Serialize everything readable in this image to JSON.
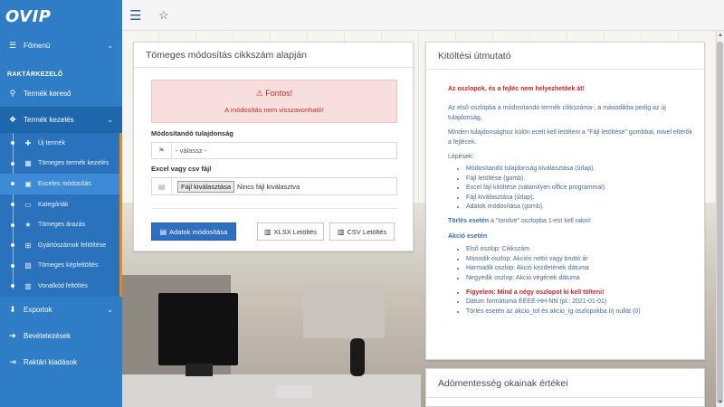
{
  "brand": {
    "logo_text": "OVIP"
  },
  "sidebar": {
    "top_item": {
      "label": "Főmenü",
      "icon": "bars-icon"
    },
    "section_title": "RAKTÁRKEZELŐ",
    "items": [
      {
        "label": "Termék kereső",
        "icon": "search-icon"
      },
      {
        "label": "Termék kezelés",
        "icon": "cubes-icon"
      }
    ],
    "submenu": [
      {
        "label": "Új termék",
        "icon": "plus-icon"
      },
      {
        "label": "Tömeges termék kezelés",
        "icon": "table-icon"
      },
      {
        "label": "Exceles módosítás",
        "icon": "file-excel-icon"
      },
      {
        "label": "Kategóriák",
        "icon": "folder-open-icon"
      },
      {
        "label": "Tömeges árazás",
        "icon": "star-icon"
      },
      {
        "label": "Gyártószámok feltöltése",
        "icon": "sitemap-icon"
      },
      {
        "label": "Tömeges képfeltöltés",
        "icon": "image-icon"
      },
      {
        "label": "Vonalkód feltöltés",
        "icon": "barcode-icon"
      }
    ],
    "bottom_items": [
      {
        "label": "Exportok",
        "icon": "download-icon"
      },
      {
        "label": "Bevételezések",
        "icon": "sign-in-icon"
      },
      {
        "label": "Raktári kiadások",
        "icon": "sign-out-icon"
      }
    ]
  },
  "form_panel": {
    "title": "Tömeges módosítás cikkszám alapján",
    "alert_title": "⚠ Fontos!",
    "alert_text": "A módosítás nem visszavonható!",
    "property_label": "Módosítandó tulajdonság",
    "property_value": "- válassz -",
    "file_label": "Excel vagy csv fájl",
    "file_button": "Fájl kiválasztása",
    "file_status": "Nincs fájl kiválasztva",
    "submit_button": "Adatok módosítása",
    "xlsx_button": "XLSX Letöltés",
    "csv_button": "CSV Letöltés"
  },
  "guide_panel": {
    "title": "Kitöltési útmutató",
    "warning": "Az oszlopok, és a fejléc nem helyezhetőek át!",
    "p1": "Az első oszlopba a módosítandó termék cikkszáma-, a másodikba pedig az új tulajdonság.",
    "p2": "Minden tulajdonsághoz külön ecelt kell letölteni a \"Fájl letöltése\" gombbal, mivel eltérők a fejlécek.",
    "steps_title": "Lépések:",
    "steps": [
      "Módosítandó tulajdonság kiválasztása (űrlap).",
      "Fájl letöltése (gomb).",
      "Excel fájl kitöltése (valamilyen office programmal).",
      "Fájl kiválasztása (űrlap).",
      "Adatok módosítása (gomb)."
    ],
    "delete_note_bold": "Törlés esetén",
    "delete_note_rest": " a \"torolve\" oszlopba 1-est kell rakni!",
    "action_title": "Akció esetén",
    "action_items": [
      "Első oszlop: Cikkszám",
      "Második oszlop: Akciós nettó vagy bruttó ár",
      "Harmadik oszlop: Akció kezdetének dátuma",
      "Negyedik oszlop: Akció végének dátuma"
    ],
    "action_extra_warning": "Figyelem: Mind a négy oszlopot ki kell tölteni!",
    "action_extra": [
      "Dátum formátuma ÉÉÉÉ-HH-NN (pl.: 2021-01-01)",
      "Törlés esetén az akcio_tol és akcio_ig oszlopokba írj nullát (0)"
    ]
  },
  "vat_panel": {
    "title": "Adómentesség okainak értékei"
  }
}
